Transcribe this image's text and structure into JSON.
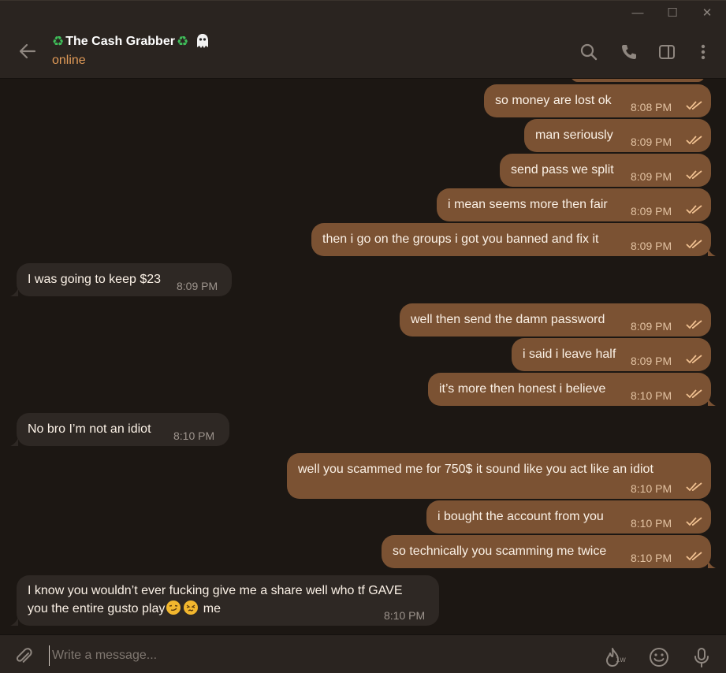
{
  "window": {
    "minimize_glyph": "—",
    "maximize_glyph": "☐",
    "close_glyph": "✕"
  },
  "header": {
    "title": "The Cash Grabber",
    "title_prefix_icon": "recycle-icon",
    "title_suffix_icon": "recycle-icon",
    "title_trailing_icon": "ghost-icon",
    "status": "online",
    "status_color": "#e09a58",
    "actions": [
      "search-icon",
      "phone-icon",
      "sidebar-toggle-icon",
      "more-vertical-icon"
    ]
  },
  "messages": [
    {
      "id": "m1",
      "direction": "out",
      "text": "so money are lost ok",
      "time": "8:08 PM",
      "read": true
    },
    {
      "id": "m2",
      "direction": "out",
      "text": "man seriously",
      "time": "8:09 PM",
      "read": true
    },
    {
      "id": "m3",
      "direction": "out",
      "text": "send pass we split",
      "time": "8:09 PM",
      "read": true
    },
    {
      "id": "m4",
      "direction": "out",
      "text": "i mean seems more then fair",
      "time": "8:09 PM",
      "read": true
    },
    {
      "id": "m5",
      "direction": "out",
      "text": "then i go on the groups i got you banned and fix it",
      "time": "8:09 PM",
      "read": true
    },
    {
      "id": "m6",
      "direction": "in",
      "text": "I was going to keep $23",
      "time": "8:09 PM"
    },
    {
      "id": "m7",
      "direction": "out",
      "text": "well then send the damn password",
      "time": "8:09 PM",
      "read": true
    },
    {
      "id": "m8",
      "direction": "out",
      "text": "i said i leave half",
      "time": "8:09 PM",
      "read": true
    },
    {
      "id": "m9",
      "direction": "out",
      "text": "it’s more then honest i believe",
      "time": "8:10 PM",
      "read": true
    },
    {
      "id": "m10",
      "direction": "in",
      "text": "No bro I’m not an idiot",
      "time": "8:10 PM"
    },
    {
      "id": "m11",
      "direction": "out",
      "text": "well you scammed me for 750$ it sound like you act like an idiot",
      "time": "8:10 PM",
      "read": true
    },
    {
      "id": "m12",
      "direction": "out",
      "text": "i bought the account from you",
      "time": "8:10 PM",
      "read": true
    },
    {
      "id": "m13",
      "direction": "out",
      "text": "so technically you scamming me twice",
      "time": "8:10 PM",
      "read": true
    },
    {
      "id": "m14",
      "direction": "in",
      "text_line1": "I know you wouldn’t ever fucking give me a share well who tf GAVE",
      "text_line2_pre": "you the entire gusto play",
      "text_line2_post": "me",
      "emojis": [
        "smirking-face-emoji",
        "persevering-face-emoji"
      ],
      "time": "8:10 PM"
    }
  ],
  "composer": {
    "placeholder": "Write a message...",
    "badge": "1w",
    "icons": [
      "paperclip-icon",
      "fire-icon",
      "smiley-icon",
      "microphone-icon"
    ]
  },
  "colors": {
    "background": "#1c1713",
    "outgoing_bubble": "#7b5233",
    "incoming_bubble": "#2e2824",
    "header": "#2a2420",
    "accent": "#e09a58",
    "read_ticks": "#f0c090"
  }
}
